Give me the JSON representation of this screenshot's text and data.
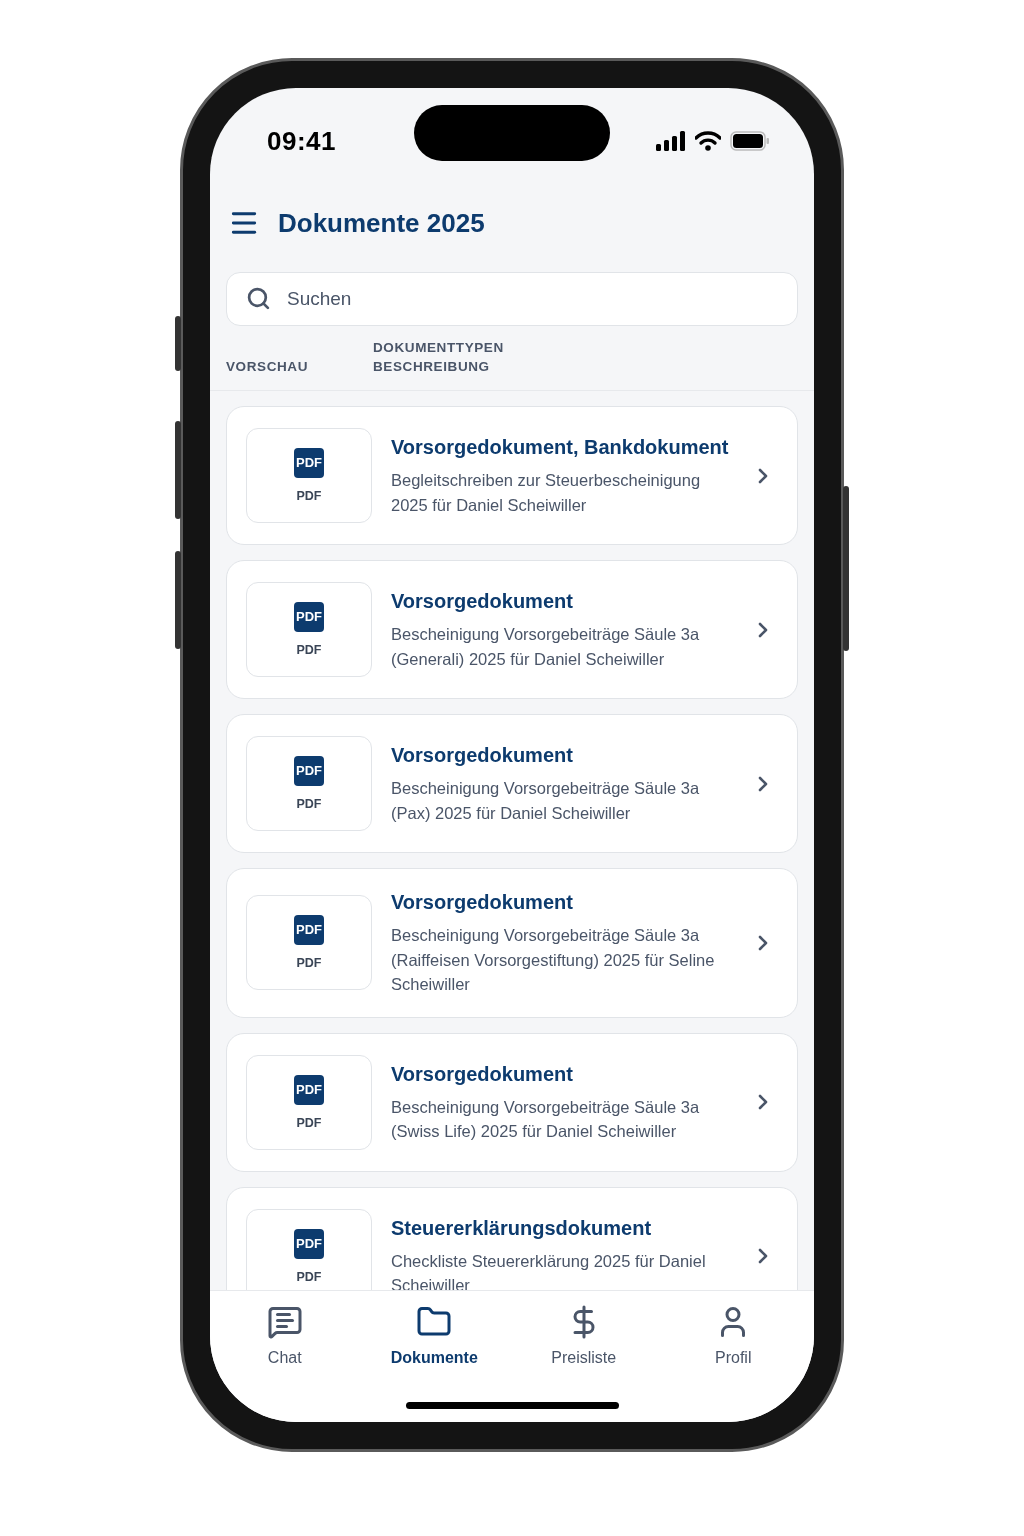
{
  "status_bar": {
    "time": "09:41"
  },
  "header": {
    "title": "Dokumente 2025"
  },
  "search": {
    "placeholder": "Suchen"
  },
  "columns": {
    "preview": "VORSCHAU",
    "type": "DOKUMENTTYPEN",
    "description": "BESCHREIBUNG"
  },
  "documents": [
    {
      "icon_text": "PDF",
      "format": "PDF",
      "title": "Vorsorgedokument, Bankdokument",
      "description": "Begleitschreiben zur Steuerbescheinigung 2025 für Daniel Scheiwiller"
    },
    {
      "icon_text": "PDF",
      "format": "PDF",
      "title": "Vorsorgedokument",
      "description": "Bescheinigung Vorsorgebeiträge Säule 3a (Generali) 2025 für Daniel Scheiwiller"
    },
    {
      "icon_text": "PDF",
      "format": "PDF",
      "title": "Vorsorgedokument",
      "description": "Bescheinigung Vorsorgebeiträge Säule 3a (Pax) 2025 für Daniel Scheiwiller"
    },
    {
      "icon_text": "PDF",
      "format": "PDF",
      "title": "Vorsorgedokument",
      "description": "Bescheinigung Vorsorgebeiträge Säule 3a (Raiffeisen Vorsorgestiftung) 2025 für Seline Scheiwiller"
    },
    {
      "icon_text": "PDF",
      "format": "PDF",
      "title": "Vorsorgedokument",
      "description": "Bescheinigung Vorsorgebeiträge Säule 3a (Swiss Life) 2025 für Daniel Scheiwiller"
    },
    {
      "icon_text": "PDF",
      "format": "PDF",
      "title": "Steuererklärungsdokument",
      "description": "Checkliste Steuererklärung 2025 für Daniel Scheiwiller"
    }
  ],
  "tab_bar": [
    {
      "kind": "chat",
      "label": "Chat",
      "selected": false
    },
    {
      "kind": "folder",
      "label": "Dokumente",
      "selected": true
    },
    {
      "kind": "price",
      "label": "Preisliste",
      "selected": false
    },
    {
      "kind": "profile",
      "label": "Profil",
      "selected": false
    }
  ]
}
